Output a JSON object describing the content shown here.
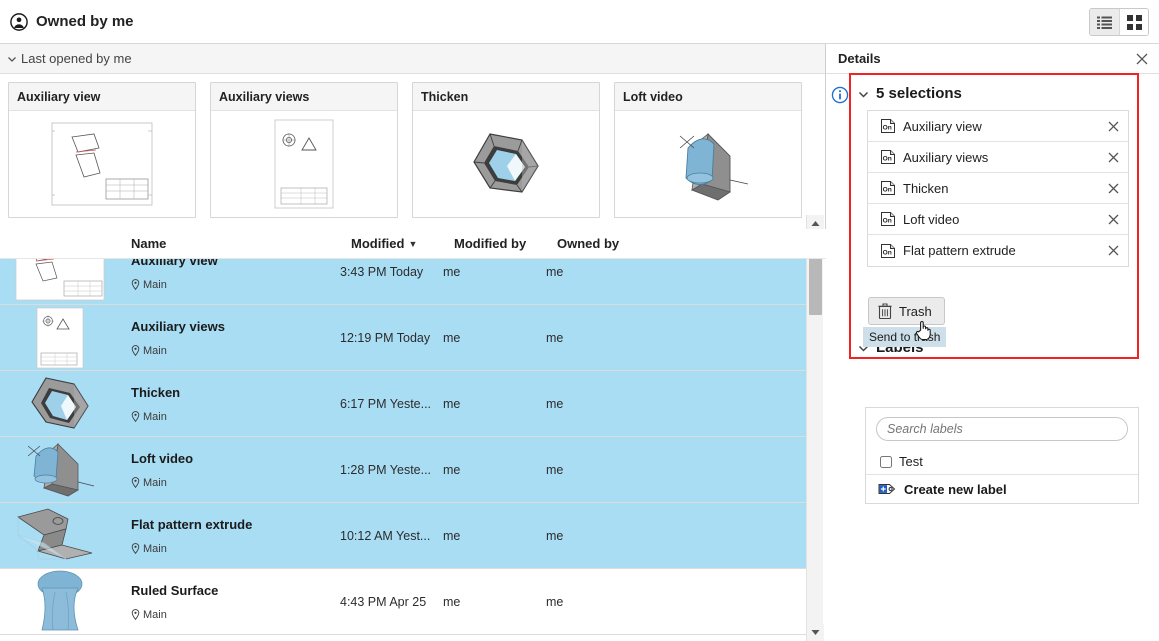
{
  "topbar": {
    "title": "Owned by me",
    "person_icon": "person-icon",
    "list_view_label": "list-view",
    "grid_view_label": "grid-view"
  },
  "main": {
    "section_label": "Last opened by me",
    "recent_cards": [
      {
        "title": "Auxiliary view",
        "thumb": "drawing-sheet"
      },
      {
        "title": "Auxiliary views",
        "thumb": "drawing-sheet-portrait"
      },
      {
        "title": "Thicken",
        "thumb": "hex-ring-solid"
      },
      {
        "title": "Loft video",
        "thumb": "loft-cone-solid"
      }
    ],
    "columns": {
      "name": "Name",
      "modified": "Modified",
      "sort_caret": "▼",
      "modified_by": "Modified by",
      "owned_by": "Owned by"
    },
    "rows": [
      {
        "name": "Auxiliary view",
        "location": "Main",
        "modified": "3:43 PM Today",
        "modified_by": "me",
        "owned_by": "me",
        "selected": true,
        "thumb": "drawing-sheet"
      },
      {
        "name": "Auxiliary views",
        "location": "Main",
        "modified": "12:19 PM Today",
        "modified_by": "me",
        "owned_by": "me",
        "selected": true,
        "thumb": "drawing-sheet-portrait"
      },
      {
        "name": "Thicken",
        "location": "Main",
        "modified": "6:17 PM Yeste...",
        "modified_by": "me",
        "owned_by": "me",
        "selected": true,
        "thumb": "hex-ring-solid"
      },
      {
        "name": "Loft video",
        "location": "Main",
        "modified": "1:28 PM Yeste...",
        "modified_by": "me",
        "owned_by": "me",
        "selected": true,
        "thumb": "loft-cone-solid"
      },
      {
        "name": "Flat pattern extrude",
        "location": "Main",
        "modified": "10:12 AM Yest...",
        "modified_by": "me",
        "owned_by": "me",
        "selected": true,
        "thumb": "flat-pattern-solid"
      },
      {
        "name": "Ruled Surface",
        "location": "Main",
        "modified": "4:43 PM Apr 25",
        "modified_by": "me",
        "owned_by": "me",
        "selected": false,
        "thumb": "ruled-surface-solid"
      }
    ]
  },
  "details": {
    "header_title": "Details",
    "close_label": "✕",
    "selections_title": "5 selections",
    "selections": [
      {
        "name": "Auxiliary view"
      },
      {
        "name": "Auxiliary views"
      },
      {
        "name": "Thicken"
      },
      {
        "name": "Loft video"
      },
      {
        "name": "Flat pattern extrude"
      }
    ],
    "trash_label": "Trash",
    "tooltip_text": "Send to trash",
    "labels_title": "Labels",
    "labels_search_placeholder": "Search labels",
    "labels": [
      {
        "name": "Test",
        "checked": false
      }
    ],
    "create_label": "Create new label"
  },
  "colors": {
    "selection_blue": "#a9ddf4",
    "highlight_red": "#f42222",
    "tooltip_bg": "#cddfe9",
    "accent_blue": "#1f6fd0"
  }
}
